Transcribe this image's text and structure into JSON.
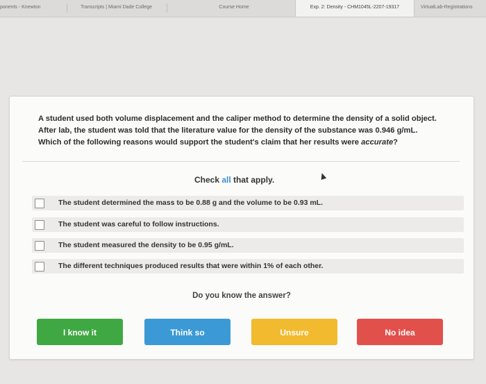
{
  "tabs": [
    {
      "label": "ponents - Knewton"
    },
    {
      "label": "Transcripts | Miami Dade College"
    },
    {
      "label": "Course Home"
    },
    {
      "label": "Exp. 2: Density - CHM1045L-2207-19317"
    },
    {
      "label": "VirtualLab-Registrations"
    }
  ],
  "question": {
    "line1": "A student used both volume displacement and the caliper method to determine the density of a solid object.",
    "line2": "After lab, the student was told that the literature value for the density of the substance was 0.946 g/mL.",
    "line3_prefix": "Which of the following reasons would support the student's claim that her results were ",
    "line3_em": "accurate",
    "line3_suffix": "?"
  },
  "instruction": {
    "prefix": "Check ",
    "highlight": "all",
    "suffix": " that apply."
  },
  "options": [
    {
      "label": "The student determined the mass to be 0.88 g and the volume to be 0.93 mL."
    },
    {
      "label": "The student was careful to follow instructions."
    },
    {
      "label": "The student measured the density to be 0.95 g/mL."
    },
    {
      "label": "The different techniques produced results that were within 1% of each other."
    }
  ],
  "prompt": "Do you know the answer?",
  "buttons": [
    {
      "label": "I know it",
      "color": "#3fa843"
    },
    {
      "label": "Think so",
      "color": "#3b9ad6"
    },
    {
      "label": "Unsure",
      "color": "#f2ba2e"
    },
    {
      "label": "No idea",
      "color": "#e2504c"
    }
  ]
}
